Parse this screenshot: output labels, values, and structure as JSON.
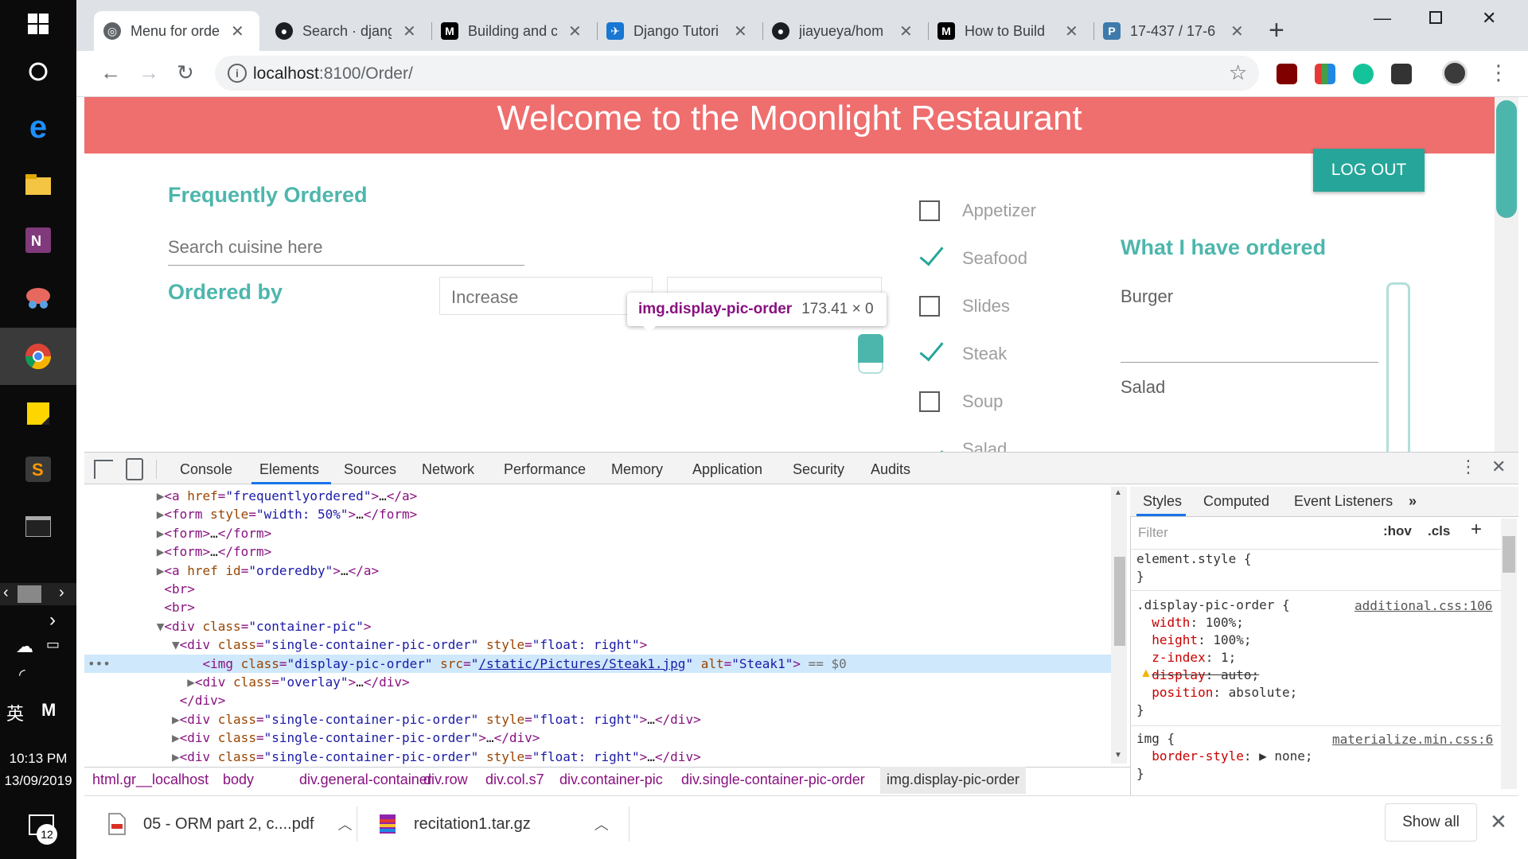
{
  "taskbar": {
    "time": "10:13 PM",
    "date": "13/09/2019",
    "ime": "英",
    "notification_count": "12",
    "icons": [
      "windows-icon",
      "cortana-icon",
      "edge-icon",
      "file-explorer-icon",
      "onenote-icon",
      "snip-icon",
      "chrome-icon",
      "sticky-notes-icon",
      "sublime-icon",
      "terminal-icon"
    ]
  },
  "browser": {
    "tabs": [
      {
        "label": "Menu for orde",
        "icon": "globe-icon",
        "active": true
      },
      {
        "label": "Search · djang",
        "icon": "github-icon"
      },
      {
        "label": "Building and c",
        "icon": "medium-icon"
      },
      {
        "label": "Django Tutori",
        "icon": "django-icon"
      },
      {
        "label": "jiayueya/hom",
        "icon": "github-icon"
      },
      {
        "label": "How to Build",
        "icon": "medium-icon"
      },
      {
        "label": "17-437 / 17-6",
        "icon": "piazza-icon"
      }
    ],
    "url_host": "localhost",
    "url_path": ":8100/Order/"
  },
  "page": {
    "banner": "Welcome to the Moonlight Restaurant",
    "logout": "LOG OUT",
    "frequently_ordered": "Frequently Ordered",
    "search_placeholder": "Search cuisine here",
    "ordered_by": "Ordered by",
    "order_select": "Increase",
    "tooltip_name": "img.display-pic-order",
    "tooltip_dims": "173.41 × 0",
    "categories": [
      {
        "label": "Appetizer",
        "checked": false
      },
      {
        "label": "Seafood",
        "checked": true
      },
      {
        "label": "Slides",
        "checked": false
      },
      {
        "label": "Steak",
        "checked": true
      },
      {
        "label": "Soup",
        "checked": false
      },
      {
        "label": "Salad",
        "checked": true
      }
    ],
    "what_ordered": "What I have ordered",
    "ordered_items": [
      "Burger",
      "Salad"
    ]
  },
  "devtools": {
    "tabs": [
      "Console",
      "Elements",
      "Sources",
      "Network",
      "Performance",
      "Memory",
      "Application",
      "Security",
      "Audits"
    ],
    "active_tab": "Elements",
    "breadcrumbs": [
      "html.gr__localhost",
      "body",
      "div.general-container",
      "div.row",
      "div.col.s7",
      "div.container-pic",
      "div.single-container-pic-order",
      "img.display-pic-order"
    ],
    "styles_tabs": [
      "Styles",
      "Computed",
      "Event Listeners"
    ],
    "filter_placeholder": "Filter",
    "hov": ":hov",
    "cls": ".cls",
    "element_style": "element.style {",
    "rule1_selector": ".display-pic-order {",
    "rule1_source": "additional.css:106",
    "rule1_props": [
      {
        "name": "width",
        "value": "100%;"
      },
      {
        "name": "height",
        "value": "100%;"
      },
      {
        "name": "z-index",
        "value": "1;"
      },
      {
        "name": "display",
        "value": "auto;",
        "struck": true
      },
      {
        "name": "position",
        "value": "absolute;"
      }
    ],
    "rule2_selector": "img {",
    "rule2_source": "materialize.min.css:6",
    "rule2_prop": {
      "name": "border-style",
      "value": "none;"
    }
  },
  "downloads": {
    "items": [
      "05 - ORM part 2, c....pdf",
      "recitation1.tar.gz"
    ],
    "show_all": "Show all"
  },
  "colors": {
    "banner": "#ef6e6e",
    "accent": "#26a69a",
    "heading": "#4db6ac"
  }
}
